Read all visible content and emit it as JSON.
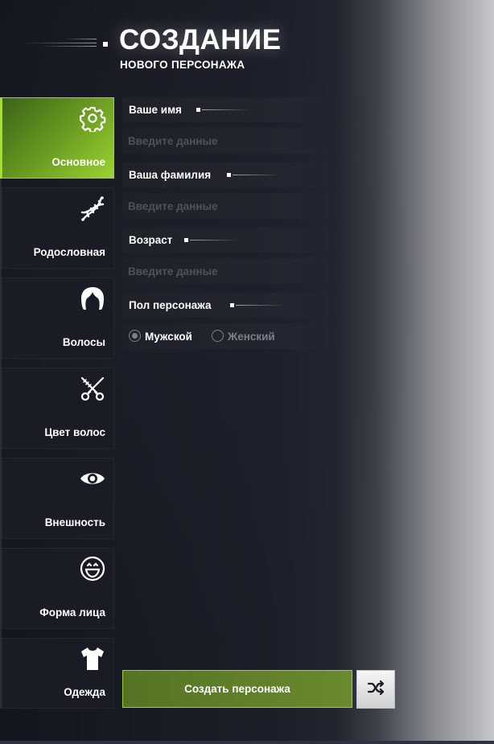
{
  "header": {
    "title": "СОЗДАНИЕ",
    "subtitle": "НОВОГО ПЕРСОНАЖА"
  },
  "sidebar": {
    "items": [
      {
        "label": "Основное",
        "icon": "gear-icon",
        "active": true
      },
      {
        "label": "Родословная",
        "icon": "dna-icon",
        "active": false
      },
      {
        "label": "Волосы",
        "icon": "hair-icon",
        "active": false
      },
      {
        "label": "Цвет волос",
        "icon": "scissors-comb-icon",
        "active": false
      },
      {
        "label": "Внешность",
        "icon": "eye-icon",
        "active": false
      },
      {
        "label": "Форма лица",
        "icon": "smile-face-icon",
        "active": false
      },
      {
        "label": "Одежда",
        "icon": "tshirt-icon",
        "active": false
      }
    ]
  },
  "form": {
    "first_name": {
      "label": "Ваше имя",
      "placeholder": "Введите данные",
      "value": ""
    },
    "last_name": {
      "label": "Ваша фамилия",
      "placeholder": "Введите данные",
      "value": ""
    },
    "age": {
      "label": "Возраст",
      "placeholder": "Введите данные",
      "value": ""
    },
    "gender": {
      "label": "Пол персонажа",
      "options": [
        {
          "label": "Мужской",
          "selected": true
        },
        {
          "label": "Женский",
          "selected": false
        }
      ]
    }
  },
  "actions": {
    "create_label": "Создать персонажа",
    "random_icon": "shuffle-icon"
  },
  "colors": {
    "accent": "#9bd431",
    "button_bg": "#6a8a2e",
    "panel_bg": "#191c24"
  }
}
